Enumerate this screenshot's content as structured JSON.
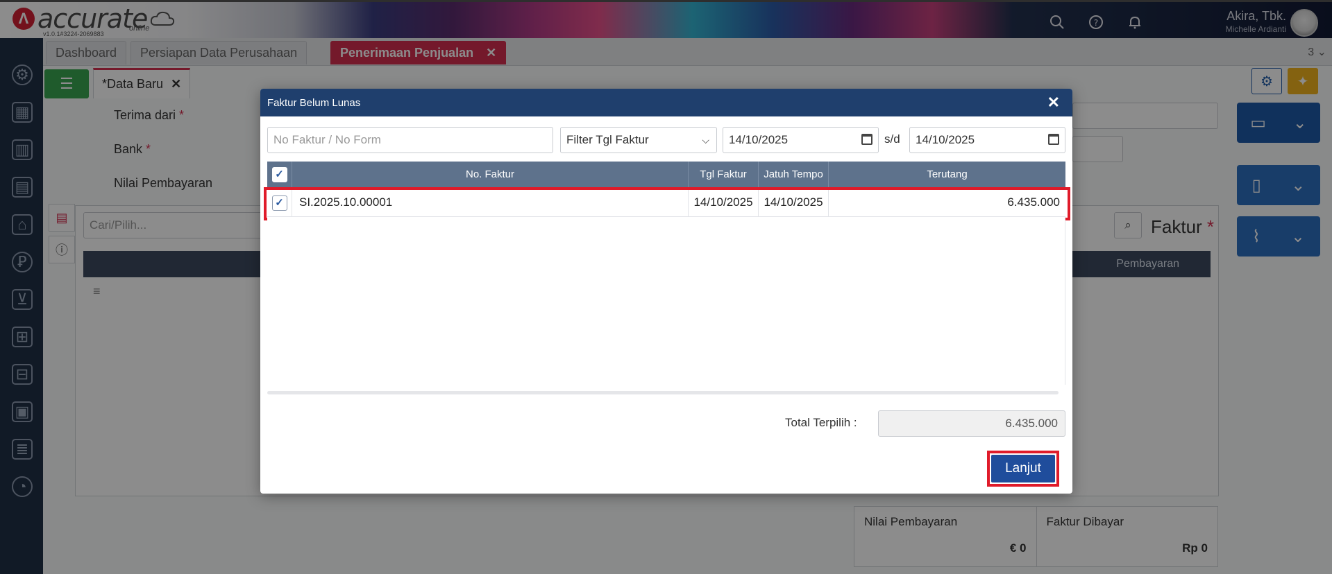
{
  "header": {
    "brand": "accurate",
    "brand_sub": "online",
    "version": "v1.0.1#3224-2069883",
    "user_name": "Akira, Tbk.",
    "user_sub": "Michelle Ardianti"
  },
  "tabs": [
    {
      "label": "Dashboard"
    },
    {
      "label": "Persiapan Data Perusahaan"
    },
    {
      "label": "Penerimaan Penjualan"
    }
  ],
  "tab_overflow": "3",
  "subtab": {
    "label": "*Data Baru"
  },
  "form": {
    "terima_dari": "Terima dari",
    "bank": "Bank",
    "nilai_pembayaran": "Nilai Pembayaran",
    "cari_placeholder": "Cari/Pilih...",
    "faktur_label": "Faktur",
    "grid_col": "Pembayaran"
  },
  "summary": {
    "nilai_label": "Nilai Pembayaran",
    "nilai_value": "€ 0",
    "faktur_label": "Faktur Dibayar",
    "faktur_value": "Rp 0"
  },
  "modal": {
    "title": "Faktur Belum Lunas",
    "search_placeholder": "No Faktur / No Form",
    "filter_select": "Filter Tgl Faktur",
    "date_from": "14/10/2025",
    "date_sep": "s/d",
    "date_to": "14/10/2025",
    "columns": [
      "No. Faktur",
      "Tgl Faktur",
      "Jatuh Tempo",
      "Terutang"
    ],
    "rows": [
      {
        "no_faktur": "SI.2025.10.00001",
        "tgl_faktur": "14/10/2025",
        "jatuh_tempo": "14/10/2025",
        "terutang": "6.435.000"
      }
    ],
    "total_label": "Total Terpilih :",
    "total_value": "6.435.000",
    "continue_label": "Lanjut"
  },
  "colors": {
    "accent_red": "#d32f4f",
    "modal_header": "#1f3f6d",
    "table_header": "#5e728c",
    "primary_button": "#1f4d9c",
    "highlight": "#e01b2a"
  }
}
